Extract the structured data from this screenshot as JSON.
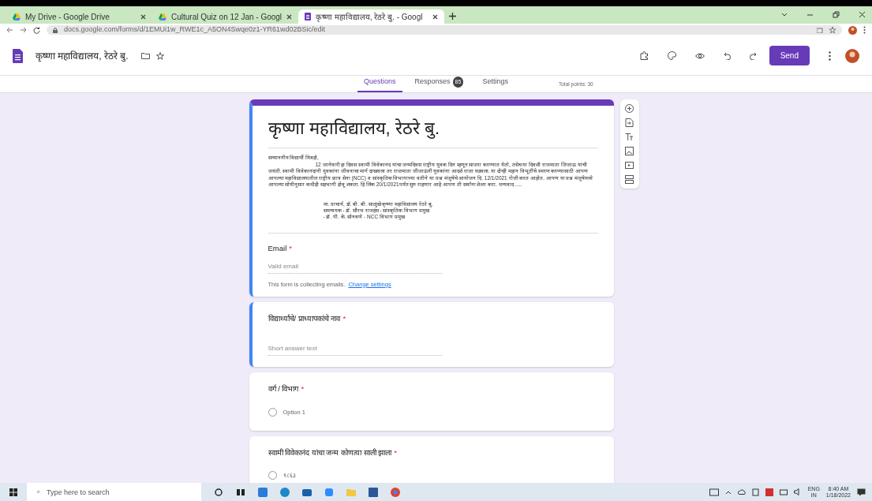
{
  "browser": {
    "tabs": [
      {
        "title": "My Drive - Google Drive",
        "selected": false,
        "kind": "drive"
      },
      {
        "title": "Cultural Quiz on 12 Jan - Googl",
        "selected": false,
        "kind": "drive"
      },
      {
        "title": "कृष्णा महाविद्यालय, रेठरे बु. - Googl",
        "selected": true,
        "kind": "forms"
      }
    ],
    "url": "docs.google.com/forms/d/1EMUi1w_RWE1c_A5ON4Swqe0z1-YR61wd02BSic/edit"
  },
  "header": {
    "title": "कृष्णा महाविद्यालय, रेठरे बु.",
    "send": "Send"
  },
  "nav": {
    "tabs": [
      {
        "label": "Questions",
        "selected": true
      },
      {
        "label": "Responses",
        "selected": false,
        "badge": "85"
      },
      {
        "label": "Settings",
        "selected": false
      }
    ],
    "total_points": "Total points: 30"
  },
  "form": {
    "title": "कृष्णा महाविद्यालय, रेठरे बु.",
    "highlighted": true,
    "greeting": "सन्माननीय विद्यार्थी मित्रहो,",
    "description": "12 जानेवारी हा दिवस स्वामी विवेकानंद यांचा जन्मदिवस राष्ट्रीय युवक दिन म्हणून साजरा करण्यात येतो, तसेच या दिवशी राजमाता जिजाऊ यांची जयंती. स्वामी विवेकानंदांनी युवकांना जीवनाचा मार्ग दाखवला तर राजमाता जीजाऊंनी युवकांना आदर्श राजा घडवला. या दोन्ही महान विभूतींचे स्मरण करण्यासाठी आपण आपल्या महाविद्यालयातील राष्ट्रीय छात्र सेना (NCC) व सांस्कृतिक विभागाच्या वतीने या प्रश्न मंजुषेचे आयोजन दि. 12/1/2021 रोजी करत आहोत. आपण या प्रश्न मंजुषेमध्ये आपल्या सोयीनुसार कधीही सहभागी होवू शकता. हि लिंक 20/1/2021पर्यंत सुरु राहणार आहे आपण ती सर्वांना शेअर करा. धन्यवाद .....",
    "signature": [
      "मा. प्राचार्य, डॉ. बी. बी. साळुंखे कृष्णा महाविद्यालय रेठरे बु.",
      "समन्वयक - डॉ. सौरभ राजहंस - सांस्कृतिक विभाग प्रमुख",
      "- डॉ. पी. के. सोनवणे - NCC विभाग प्रमुख"
    ],
    "email": {
      "label": "Email",
      "required_mark": "*",
      "placeholder": "Valid email",
      "note": "This form is collecting emails.",
      "link": "Change settings"
    }
  },
  "questions": [
    {
      "kind": "short",
      "title": "विद्यार्थ्यांचे/ प्राध्यापकांचे नाव",
      "required_mark": "*",
      "highlighted": true,
      "placeholder": "Short answer text"
    },
    {
      "kind": "radio",
      "title": "वर्ग / विभाग",
      "required_mark": "*",
      "highlighted": false,
      "options": [
        {
          "label": "Option 1",
          "selected": false
        }
      ]
    },
    {
      "kind": "radio",
      "title": "स्वामी विवेकानंद यांचा जन्म कोणत्या साली झाला",
      "required_mark": "*",
      "highlighted": false,
      "options": [
        {
          "label": "१८६३",
          "selected": false
        }
      ]
    }
  ],
  "taskbar": {
    "search_placeholder": "Type here to search",
    "lang": "ENG",
    "region": "IN",
    "time": "8:40 AM",
    "date": "1/18/2022"
  }
}
